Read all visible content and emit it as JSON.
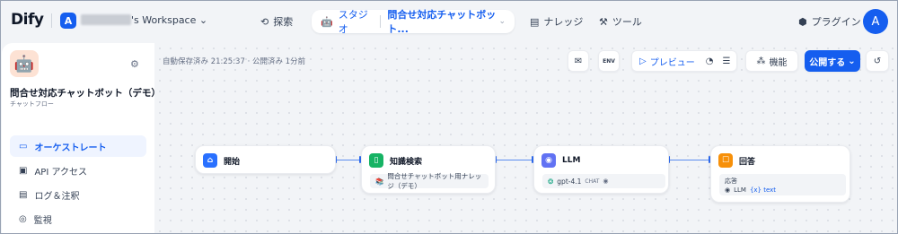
{
  "brand": {
    "logo": "Dify"
  },
  "workspace": {
    "avatar": "A",
    "name": "'s Workspace ⌄"
  },
  "nav": {
    "explore": "探索",
    "studio": "スタジオ",
    "current_app": "問合せ対応チャットボット...",
    "knowledge": "ナレッジ",
    "tools": "ツール",
    "plugins": "プラグイン"
  },
  "user": {
    "avatar": "A"
  },
  "app": {
    "icon": "🤖",
    "title": "問合せ対応チャットボット（デモ）",
    "type": "チャットフロー"
  },
  "sidebar": {
    "items": [
      {
        "label": "オーケストレート",
        "icon": "orchestrate-icon",
        "active": true
      },
      {
        "label": "API アクセス",
        "icon": "terminal-icon",
        "active": false
      },
      {
        "label": "ログ＆注釈",
        "icon": "log-icon",
        "active": false
      },
      {
        "label": "監視",
        "icon": "monitor-icon",
        "active": false
      }
    ]
  },
  "canvas": {
    "status": "自動保存済み 21:25:37 · 公開済み 1分前"
  },
  "toolbar": {
    "preview": "プレビュー",
    "features": "機能",
    "publish": "公開する",
    "env": "ENV"
  },
  "nodes": [
    {
      "title": "開始",
      "icon": "home-icon",
      "color": "#2970ff"
    },
    {
      "title": "知識検索",
      "icon": "knowledge-icon",
      "color": "#16b364",
      "chip": "問合せチャットボット用ナレッジ（デモ）"
    },
    {
      "title": "LLM",
      "icon": "llm-icon",
      "color": "#6172f3",
      "chip": "gpt-4.1",
      "badge": "CHAT"
    },
    {
      "title": "回答",
      "icon": "answer-icon",
      "color": "#f79009",
      "label": "応答",
      "var_source": "LLM",
      "var_name": "{x} text"
    }
  ]
}
